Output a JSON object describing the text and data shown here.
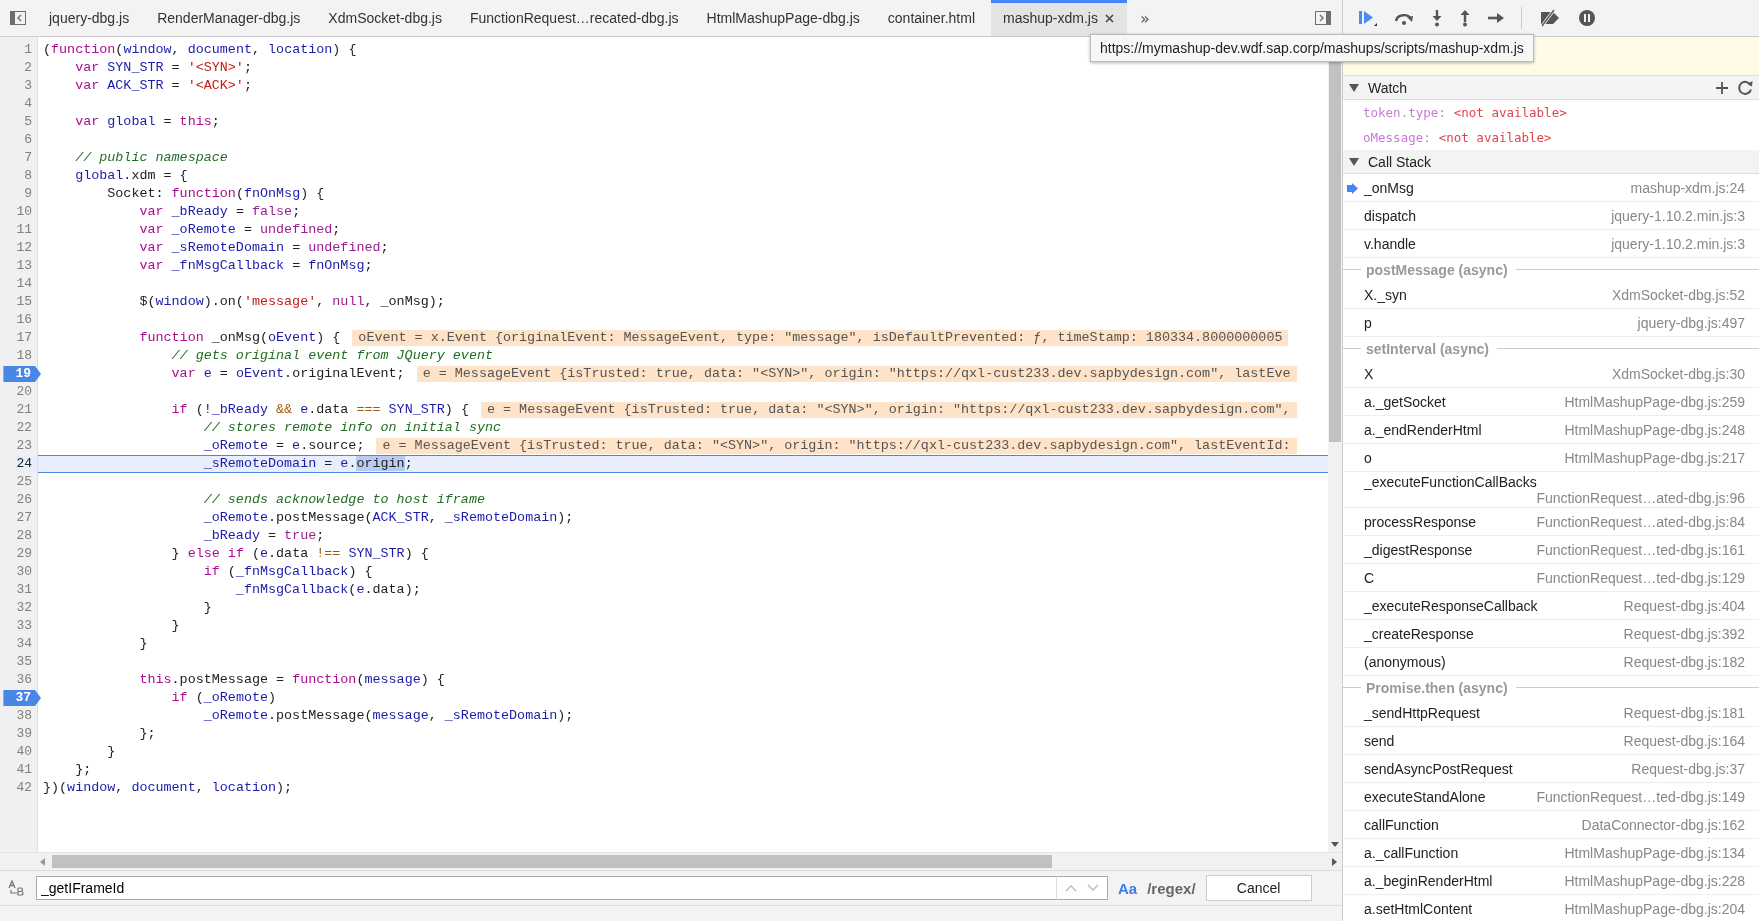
{
  "tabs": [
    {
      "label": "jquery-dbg.js",
      "selected": false,
      "closable": false
    },
    {
      "label": "RenderManager-dbg.js",
      "selected": false,
      "closable": false
    },
    {
      "label": "XdmSocket-dbg.js",
      "selected": false,
      "closable": false
    },
    {
      "label": "FunctionRequest…recated-dbg.js",
      "selected": false,
      "closable": false
    },
    {
      "label": "HtmlMashupPage-dbg.js",
      "selected": false,
      "closable": false
    },
    {
      "label": "container.html",
      "selected": false,
      "closable": false
    },
    {
      "label": "mashup-xdm.js",
      "selected": true,
      "closable": true
    }
  ],
  "more_tabs": "»",
  "tooltip": "https://mymashup-dev.wdf.sap.corp/mashups/scripts/mashup-xdm.js",
  "editor": {
    "lines": [
      {
        "number": "1",
        "breakpoint": false,
        "current": false,
        "tokens": [
          {
            "kind": "p",
            "text": "("
          },
          {
            "kind": "k",
            "text": "function"
          },
          {
            "kind": "p",
            "text": "("
          },
          {
            "kind": "v",
            "text": "window"
          },
          {
            "kind": "p",
            "text": ", "
          },
          {
            "kind": "v",
            "text": "document"
          },
          {
            "kind": "p",
            "text": ", "
          },
          {
            "kind": "v",
            "text": "location"
          },
          {
            "kind": "p",
            "text": ") {"
          }
        ]
      },
      {
        "number": "2",
        "breakpoint": false,
        "current": false,
        "tokens": [
          {
            "kind": "k",
            "text": "    var"
          },
          {
            "kind": "v",
            "text": " SYN_STR"
          },
          {
            "kind": "p",
            "text": " = "
          },
          {
            "kind": "s",
            "text": "'<SYN>'"
          },
          {
            "kind": "p",
            "text": ";"
          }
        ]
      },
      {
        "number": "3",
        "breakpoint": false,
        "current": false,
        "tokens": [
          {
            "kind": "k",
            "text": "    var"
          },
          {
            "kind": "v",
            "text": " ACK_STR"
          },
          {
            "kind": "p",
            "text": " = "
          },
          {
            "kind": "s",
            "text": "'<ACK>'"
          },
          {
            "kind": "p",
            "text": ";"
          }
        ]
      },
      {
        "number": "4",
        "breakpoint": false,
        "current": false
      },
      {
        "number": "5",
        "breakpoint": false,
        "current": false,
        "tokens": [
          {
            "kind": "k",
            "text": "    var"
          },
          {
            "kind": "v",
            "text": " global"
          },
          {
            "kind": "p",
            "text": " = "
          },
          {
            "kind": "k",
            "text": "this"
          },
          {
            "kind": "p",
            "text": ";"
          }
        ]
      },
      {
        "number": "6",
        "breakpoint": false,
        "current": false
      },
      {
        "number": "7",
        "breakpoint": false,
        "current": false,
        "tokens": [
          {
            "kind": "c",
            "text": "    // public namespace"
          }
        ]
      },
      {
        "number": "8",
        "breakpoint": false,
        "current": false,
        "tokens": [
          {
            "kind": "v",
            "text": "    global"
          },
          {
            "kind": "p",
            "text": ".xdm = {"
          }
        ]
      },
      {
        "number": "9",
        "breakpoint": false,
        "current": false,
        "tokens": [
          {
            "kind": "p",
            "text": "        Socket: "
          },
          {
            "kind": "k",
            "text": "function"
          },
          {
            "kind": "p",
            "text": "("
          },
          {
            "kind": "v",
            "text": "fnOnMsg"
          },
          {
            "kind": "p",
            "text": ") {"
          }
        ]
      },
      {
        "number": "10",
        "breakpoint": false,
        "current": false,
        "tokens": [
          {
            "kind": "k",
            "text": "            var"
          },
          {
            "kind": "v",
            "text": " _bReady"
          },
          {
            "kind": "p",
            "text": " = "
          },
          {
            "kind": "a",
            "text": "false"
          },
          {
            "kind": "p",
            "text": ";"
          }
        ]
      },
      {
        "number": "11",
        "breakpoint": false,
        "current": false,
        "tokens": [
          {
            "kind": "k",
            "text": "            var"
          },
          {
            "kind": "v",
            "text": " _oRemote"
          },
          {
            "kind": "p",
            "text": " = "
          },
          {
            "kind": "a",
            "text": "undefined"
          },
          {
            "kind": "p",
            "text": ";"
          }
        ]
      },
      {
        "number": "12",
        "breakpoint": false,
        "current": false,
        "tokens": [
          {
            "kind": "k",
            "text": "            var"
          },
          {
            "kind": "v",
            "text": " _sRemoteDomain"
          },
          {
            "kind": "p",
            "text": " = "
          },
          {
            "kind": "a",
            "text": "undefined"
          },
          {
            "kind": "p",
            "text": ";"
          }
        ]
      },
      {
        "number": "13",
        "breakpoint": false,
        "current": false,
        "tokens": [
          {
            "kind": "k",
            "text": "            var"
          },
          {
            "kind": "v",
            "text": " _fnMsgCallback"
          },
          {
            "kind": "p",
            "text": " = "
          },
          {
            "kind": "v",
            "text": "fnOnMsg"
          },
          {
            "kind": "p",
            "text": ";"
          }
        ]
      },
      {
        "number": "14",
        "breakpoint": false,
        "current": false
      },
      {
        "number": "15",
        "breakpoint": false,
        "current": false,
        "tokens": [
          {
            "kind": "p",
            "text": "            $("
          },
          {
            "kind": "v",
            "text": "window"
          },
          {
            "kind": "p",
            "text": ").on("
          },
          {
            "kind": "s",
            "text": "'message'"
          },
          {
            "kind": "p",
            "text": ", "
          },
          {
            "kind": "a",
            "text": "null"
          },
          {
            "kind": "p",
            "text": ", _onMsg);"
          }
        ]
      },
      {
        "number": "16",
        "breakpoint": false,
        "current": false
      },
      {
        "number": "17",
        "breakpoint": false,
        "current": false,
        "tokens": [
          {
            "kind": "k",
            "text": "            function"
          },
          {
            "kind": "p",
            "text": " _onMsg("
          },
          {
            "kind": "v",
            "text": "oEvent"
          },
          {
            "kind": "p",
            "text": ") {"
          }
        ],
        "inline_value": "oEvent = x.Event {originalEvent: MessageEvent, type: \"message\", isDefaultPrevented: ƒ, timeStamp: 180334.8000000005"
      },
      {
        "number": "18",
        "breakpoint": false,
        "current": false,
        "tokens": [
          {
            "kind": "c",
            "text": "                // gets original event from JQuery event"
          }
        ]
      },
      {
        "number": "19",
        "breakpoint": true,
        "current": false,
        "tokens": [
          {
            "kind": "k",
            "text": "                var"
          },
          {
            "kind": "v",
            "text": " e"
          },
          {
            "kind": "p",
            "text": " = "
          },
          {
            "kind": "v",
            "text": "oEvent"
          },
          {
            "kind": "p",
            "text": ".originalEvent;"
          }
        ],
        "inline_value": "e = MessageEvent {isTrusted: true, data: \"<SYN>\", origin: \"https://qxl-cust233.dev.sapbydesign.com\", lastEve"
      },
      {
        "number": "20",
        "breakpoint": false,
        "current": false
      },
      {
        "number": "21",
        "breakpoint": false,
        "current": false,
        "tokens": [
          {
            "kind": "k",
            "text": "                if"
          },
          {
            "kind": "p",
            "text": " (!"
          },
          {
            "kind": "v",
            "text": "_bReady"
          },
          {
            "kind": "o",
            "text": " && "
          },
          {
            "kind": "v",
            "text": "e"
          },
          {
            "kind": "p",
            "text": ".data "
          },
          {
            "kind": "o",
            "text": "==="
          },
          {
            "kind": "v",
            "text": " SYN_STR"
          },
          {
            "kind": "p",
            "text": ") {"
          }
        ],
        "inline_value": "e = MessageEvent {isTrusted: true, data: \"<SYN>\", origin: \"https://qxl-cust233.dev.sapbydesign.com\","
      },
      {
        "number": "22",
        "breakpoint": false,
        "current": false,
        "tokens": [
          {
            "kind": "c",
            "text": "                    // stores remote info on initial sync"
          }
        ]
      },
      {
        "number": "23",
        "breakpoint": false,
        "current": false,
        "tokens": [
          {
            "kind": "v",
            "text": "                    _oRemote"
          },
          {
            "kind": "p",
            "text": " = "
          },
          {
            "kind": "v",
            "text": "e"
          },
          {
            "kind": "p",
            "text": ".source;"
          }
        ],
        "inline_value": "e = MessageEvent {isTrusted: true, data: \"<SYN>\", origin: \"https://qxl-cust233.dev.sapbydesign.com\", lastEventId:"
      },
      {
        "number": "24",
        "breakpoint": false,
        "current": true,
        "tokens": [
          {
            "kind": "v",
            "text": "                    _sRemoteDomain"
          },
          {
            "kind": "p",
            "text": " = "
          },
          {
            "kind": "v",
            "text": "e"
          },
          {
            "kind": "p",
            "text": "."
          },
          {
            "kind": "m",
            "text": "origin"
          },
          {
            "kind": "p",
            "text": ";"
          }
        ]
      },
      {
        "number": "25",
        "breakpoint": false,
        "current": false
      },
      {
        "number": "26",
        "breakpoint": false,
        "current": false,
        "tokens": [
          {
            "kind": "c",
            "text": "                    // sends acknowledge to host iframe"
          }
        ]
      },
      {
        "number": "27",
        "breakpoint": false,
        "current": false,
        "tokens": [
          {
            "kind": "v",
            "text": "                    _oRemote"
          },
          {
            "kind": "p",
            "text": ".postMessage("
          },
          {
            "kind": "v",
            "text": "ACK_STR"
          },
          {
            "kind": "p",
            "text": ", "
          },
          {
            "kind": "v",
            "text": "_sRemoteDomain"
          },
          {
            "kind": "p",
            "text": ");"
          }
        ]
      },
      {
        "number": "28",
        "breakpoint": false,
        "current": false,
        "tokens": [
          {
            "kind": "v",
            "text": "                    _bReady"
          },
          {
            "kind": "p",
            "text": " = "
          },
          {
            "kind": "a",
            "text": "true"
          },
          {
            "kind": "p",
            "text": ";"
          }
        ]
      },
      {
        "number": "29",
        "breakpoint": false,
        "current": false,
        "tokens": [
          {
            "kind": "p",
            "text": "                } "
          },
          {
            "kind": "k",
            "text": "else"
          },
          {
            "kind": "k",
            "text": " if"
          },
          {
            "kind": "p",
            "text": " ("
          },
          {
            "kind": "v",
            "text": "e"
          },
          {
            "kind": "p",
            "text": ".data "
          },
          {
            "kind": "o",
            "text": "!=="
          },
          {
            "kind": "v",
            "text": " SYN_STR"
          },
          {
            "kind": "p",
            "text": ") {"
          }
        ]
      },
      {
        "number": "30",
        "breakpoint": false,
        "current": false,
        "tokens": [
          {
            "kind": "k",
            "text": "                    if"
          },
          {
            "kind": "p",
            "text": " ("
          },
          {
            "kind": "v",
            "text": "_fnMsgCallback"
          },
          {
            "kind": "p",
            "text": ") {"
          }
        ]
      },
      {
        "number": "31",
        "breakpoint": false,
        "current": false,
        "tokens": [
          {
            "kind": "v",
            "text": "                        _fnMsgCallback"
          },
          {
            "kind": "p",
            "text": "("
          },
          {
            "kind": "v",
            "text": "e"
          },
          {
            "kind": "p",
            "text": ".data);"
          }
        ]
      },
      {
        "number": "32",
        "breakpoint": false,
        "current": false,
        "tokens": [
          {
            "kind": "p",
            "text": "                    }"
          }
        ]
      },
      {
        "number": "33",
        "breakpoint": false,
        "current": false,
        "tokens": [
          {
            "kind": "p",
            "text": "                }"
          }
        ]
      },
      {
        "number": "34",
        "breakpoint": false,
        "current": false,
        "tokens": [
          {
            "kind": "p",
            "text": "            }"
          }
        ]
      },
      {
        "number": "35",
        "breakpoint": false,
        "current": false
      },
      {
        "number": "36",
        "breakpoint": false,
        "current": false,
        "tokens": [
          {
            "kind": "k",
            "text": "            this"
          },
          {
            "kind": "p",
            "text": ".postMessage = "
          },
          {
            "kind": "k",
            "text": "function"
          },
          {
            "kind": "p",
            "text": "("
          },
          {
            "kind": "v",
            "text": "message"
          },
          {
            "kind": "p",
            "text": ") {"
          }
        ]
      },
      {
        "number": "37",
        "breakpoint": true,
        "current": false,
        "tokens": [
          {
            "kind": "k",
            "text": "                if"
          },
          {
            "kind": "p",
            "text": " ("
          },
          {
            "kind": "v",
            "text": "_oRemote"
          },
          {
            "kind": "p",
            "text": ")"
          }
        ]
      },
      {
        "number": "38",
        "breakpoint": false,
        "current": false,
        "tokens": [
          {
            "kind": "v",
            "text": "                    _oRemote"
          },
          {
            "kind": "p",
            "text": ".postMessage("
          },
          {
            "kind": "v",
            "text": "message"
          },
          {
            "kind": "p",
            "text": ", "
          },
          {
            "kind": "v",
            "text": "_sRemoteDomain"
          },
          {
            "kind": "p",
            "text": ");"
          }
        ]
      },
      {
        "number": "39",
        "breakpoint": false,
        "current": false,
        "tokens": [
          {
            "kind": "p",
            "text": "            };"
          }
        ]
      },
      {
        "number": "40",
        "breakpoint": false,
        "current": false,
        "tokens": [
          {
            "kind": "p",
            "text": "        }"
          }
        ]
      },
      {
        "number": "41",
        "breakpoint": false,
        "current": false,
        "tokens": [
          {
            "kind": "p",
            "text": "    };"
          }
        ]
      },
      {
        "number": "42",
        "breakpoint": false,
        "current": false,
        "tokens": [
          {
            "kind": "p",
            "text": "})("
          },
          {
            "kind": "v",
            "text": "window"
          },
          {
            "kind": "p",
            "text": ", "
          },
          {
            "kind": "v",
            "text": "document"
          },
          {
            "kind": "p",
            "text": ", "
          },
          {
            "kind": "v",
            "text": "location"
          },
          {
            "kind": "p",
            "text": ");"
          }
        ]
      }
    ]
  },
  "search": {
    "value": "_getIFrameId",
    "match_case": {
      "label": "Aa",
      "on": true
    },
    "regex": {
      "label": "/regex/",
      "on": false
    },
    "cancel": "Cancel"
  },
  "watch": {
    "title": "Watch",
    "expanded": true,
    "items": [
      {
        "expression": "token.type:",
        "value": "<not available>"
      },
      {
        "expression": "oMessage:",
        "value": "<not available>"
      }
    ]
  },
  "call_stack": {
    "title": "Call Stack",
    "expanded": true,
    "frames": [
      {
        "kind": "frame",
        "name": "_onMsg",
        "location": "mashup-xdm.js:24",
        "selected": true
      },
      {
        "kind": "frame",
        "name": "dispatch",
        "location": "jquery-1.10.2.min.js:3",
        "selected": false
      },
      {
        "kind": "frame",
        "name": "v.handle",
        "location": "jquery-1.10.2.min.js:3",
        "selected": false
      },
      {
        "kind": "async",
        "name": "postMessage (async)"
      },
      {
        "kind": "frame",
        "name": "X._syn",
        "location": "XdmSocket-dbg.js:52",
        "selected": false
      },
      {
        "kind": "frame",
        "name": "p",
        "location": "jquery-dbg.js:497",
        "selected": false
      },
      {
        "kind": "async",
        "name": "setInterval (async)"
      },
      {
        "kind": "frame",
        "name": "X",
        "location": "XdmSocket-dbg.js:30",
        "selected": false
      },
      {
        "kind": "frame",
        "name": "a._getSocket",
        "location": "HtmlMashupPage-dbg.js:259",
        "selected": false
      },
      {
        "kind": "frame",
        "name": "a._endRenderHtml",
        "location": "HtmlMashupPage-dbg.js:248",
        "selected": false
      },
      {
        "kind": "frame",
        "name": "o",
        "location": "HtmlMashupPage-dbg.js:217",
        "selected": false
      },
      {
        "kind": "frame",
        "name": "_executeFunctionCallBacks",
        "location": "FunctionRequest…ated-dbg.js:96",
        "selected": false
      },
      {
        "kind": "frame",
        "name": "processResponse",
        "location": "FunctionRequest…ated-dbg.js:84",
        "selected": false
      },
      {
        "kind": "frame",
        "name": "_digestResponse",
        "location": "FunctionRequest…ted-dbg.js:161",
        "selected": false
      },
      {
        "kind": "frame",
        "name": "C",
        "location": "FunctionRequest…ted-dbg.js:129",
        "selected": false
      },
      {
        "kind": "frame",
        "name": "_executeResponseCallback",
        "location": "Request-dbg.js:404",
        "selected": false
      },
      {
        "kind": "frame",
        "name": "_createResponse",
        "location": "Request-dbg.js:392",
        "selected": false
      },
      {
        "kind": "frame",
        "name": "(anonymous)",
        "location": "Request-dbg.js:182",
        "selected": false
      },
      {
        "kind": "async",
        "name": "Promise.then (async)"
      },
      {
        "kind": "frame",
        "name": "_sendHttpRequest",
        "location": "Request-dbg.js:181",
        "selected": false
      },
      {
        "kind": "frame",
        "name": "send",
        "location": "Request-dbg.js:164",
        "selected": false
      },
      {
        "kind": "frame",
        "name": "sendAsyncPostRequest",
        "location": "Request-dbg.js:37",
        "selected": false
      },
      {
        "kind": "frame",
        "name": "executeStandAlone",
        "location": "FunctionRequest…ted-dbg.js:149",
        "selected": false
      },
      {
        "kind": "frame",
        "name": "callFunction",
        "location": "DataConnector-dbg.js:162",
        "selected": false
      },
      {
        "kind": "frame",
        "name": "a._callFunction",
        "location": "HtmlMashupPage-dbg.js:134",
        "selected": false
      },
      {
        "kind": "frame",
        "name": "a._beginRenderHtml",
        "location": "HtmlMashupPage-dbg.js:228",
        "selected": false
      },
      {
        "kind": "frame",
        "name": "a.setHtmlContent",
        "location": "HtmlMashupPage-dbg.js:204",
        "selected": false
      }
    ]
  }
}
